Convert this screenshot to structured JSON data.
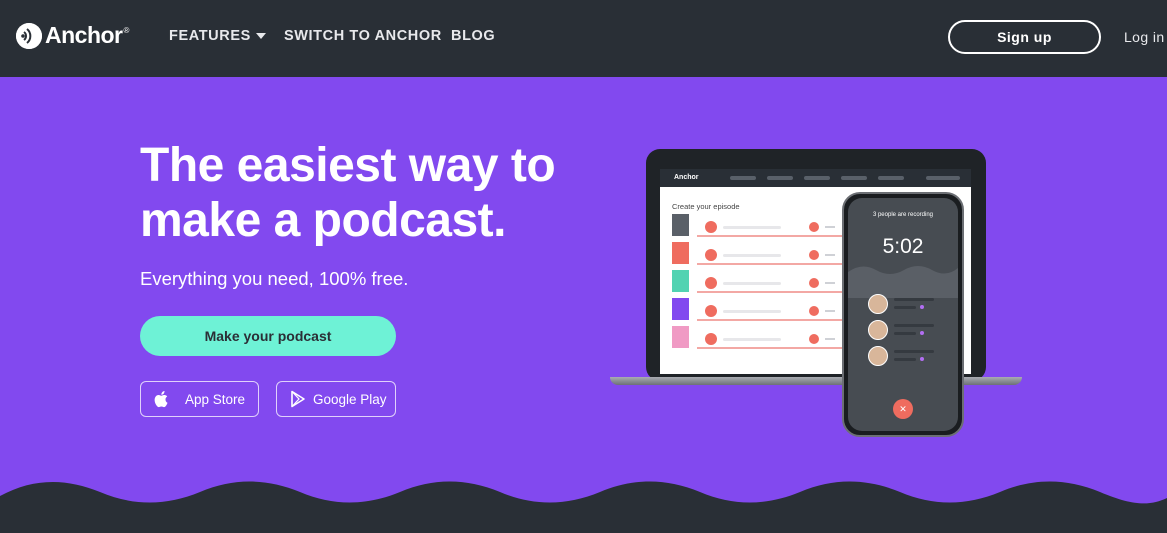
{
  "nav": {
    "logo_text": "Anchor",
    "logo_mark": "®",
    "features_label": "FEATURES",
    "switch_label": "SWITCH TO ANCHOR",
    "blog_label": "BLOG",
    "signup_label": "Sign up",
    "login_label": "Log in"
  },
  "hero": {
    "headline": "The easiest way to make a podcast.",
    "subline": "Everything you need, 100% free.",
    "cta_label": "Make your podcast",
    "app_store_label": "App Store",
    "google_play_label": "Google Play"
  },
  "illustration": {
    "laptop_brand": "Anchor",
    "create_episode_label": "Create your episode",
    "recording_status": "3 people are recording",
    "timer": "5:02"
  },
  "colors": {
    "nav_background": "#292f36",
    "hero_purple": "#8249ef",
    "cta_mint": "#6ef2d6",
    "record_red": "#ef6c5f"
  },
  "icons": {
    "logo": "anchor-logo-icon",
    "features_caret": "caret-down-icon",
    "app_store": "apple-icon",
    "google_play": "google-play-icon"
  }
}
